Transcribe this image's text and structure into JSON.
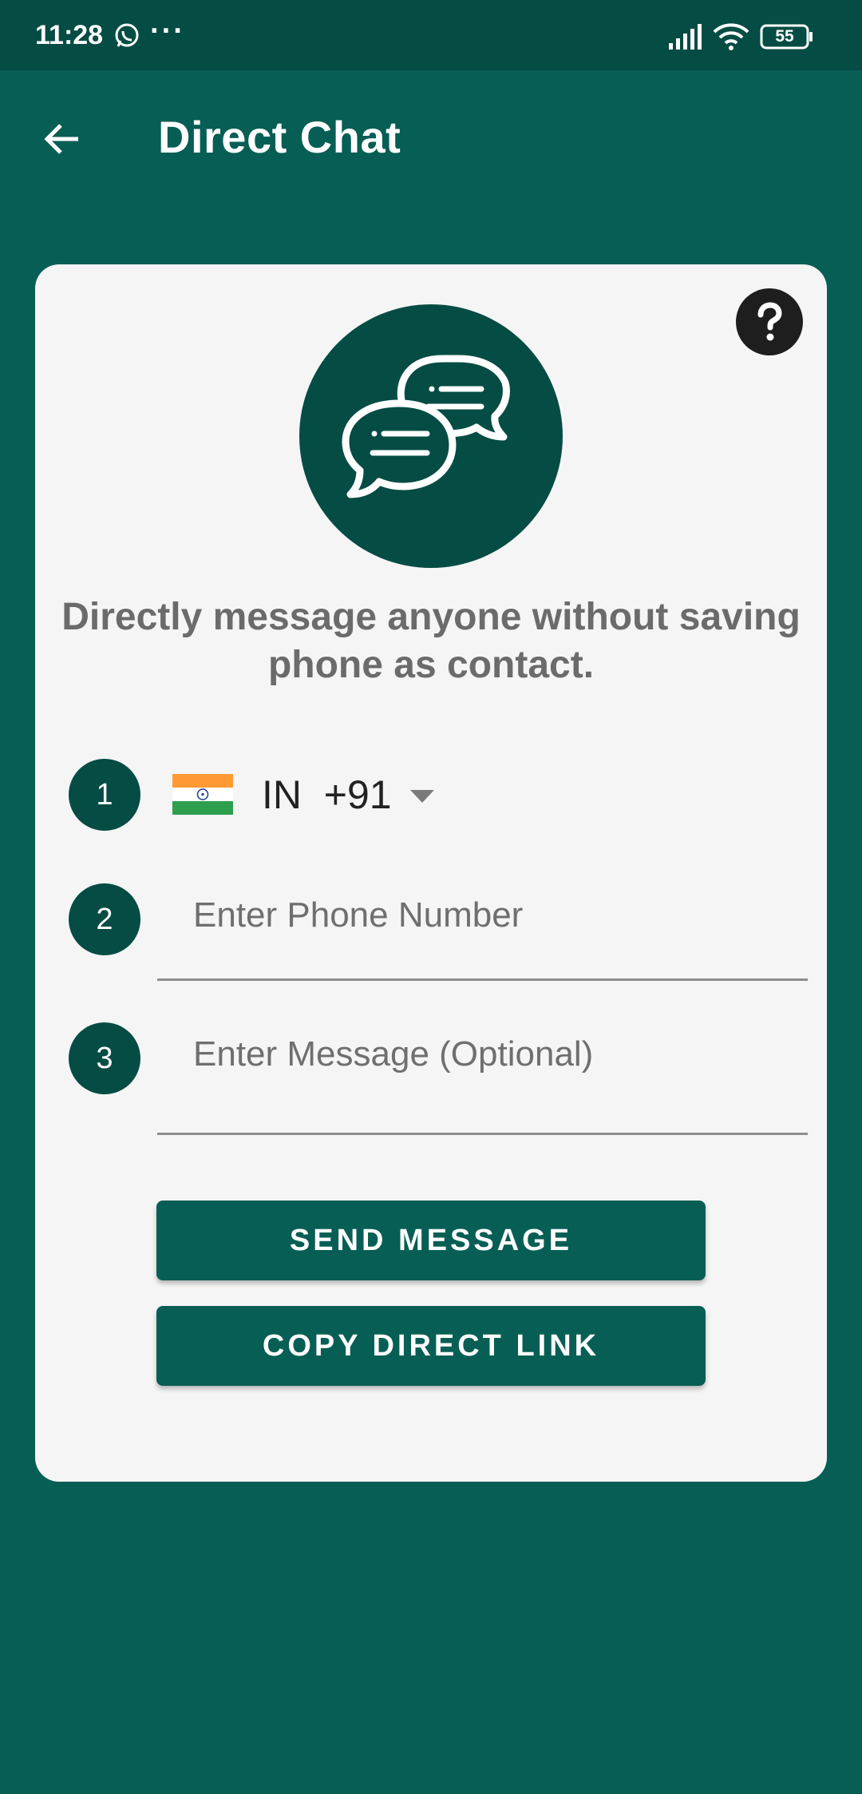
{
  "status_bar": {
    "time": "11:28",
    "dots": "···",
    "battery": "55",
    "icons": [
      "whatsapp-icon",
      "signal-icon",
      "wifi-icon",
      "battery-icon"
    ]
  },
  "app_bar": {
    "title": "Direct Chat",
    "back_icon": "arrow-back-icon"
  },
  "card": {
    "help_icon": "help-icon",
    "hero_icon": "chat-bubbles-icon",
    "tagline": "Directly message anyone without saving phone as contact.",
    "steps": [
      "1",
      "2",
      "3"
    ],
    "country": {
      "flag": "india-flag-icon",
      "code": "IN  +91"
    },
    "phone_placeholder": "Enter Phone Number",
    "message_placeholder": "Enter Message (Optional)",
    "send_label": "SEND MESSAGE",
    "copy_label": "COPY DIRECT LINK"
  },
  "colors": {
    "primary": "#075e54",
    "primary_dark": "#054c44",
    "card_bg": "#f5f5f5"
  }
}
